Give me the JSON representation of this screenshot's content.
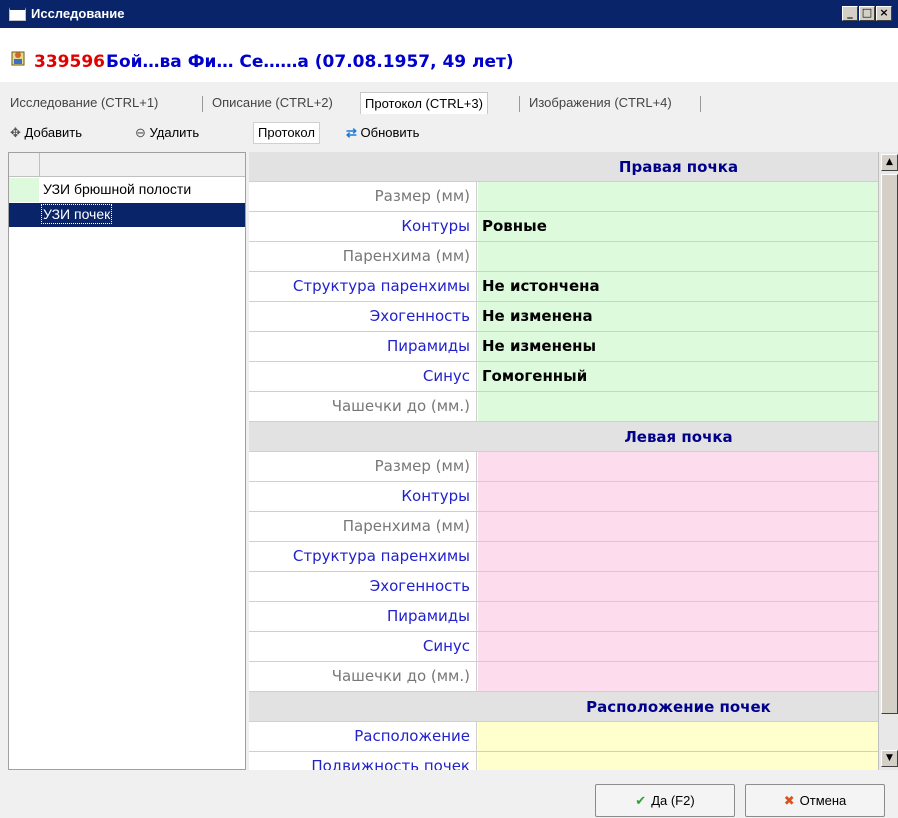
{
  "window": {
    "title": "Исследование",
    "minimize": "_",
    "maximize": "□",
    "close": "×"
  },
  "patient": {
    "id": "339596",
    "name": "Бой…ва Фи… Се……а (07.08.1957, 49 лет)"
  },
  "tabs": [
    {
      "label": "Исследование (CTRL+1)"
    },
    {
      "label": "Описание (CTRL+2)"
    },
    {
      "label": "Протокол (CTRL+3)"
    },
    {
      "label": "Изображения (CTRL+4)"
    }
  ],
  "left_toolbar": {
    "add": "Добавить",
    "remove": "Удалить"
  },
  "right_toolbar": {
    "protocol": "Протокол",
    "refresh": "Обновить"
  },
  "studies": [
    {
      "label": "УЗИ брюшной полости"
    },
    {
      "label": "УЗИ почек"
    }
  ],
  "sections": [
    {
      "title": "Правая почка",
      "rows": [
        {
          "label": "Размер (мм)",
          "value": ""
        },
        {
          "label": "Контуры",
          "value": "Ровные"
        },
        {
          "label": "Паренхима (мм)",
          "value": ""
        },
        {
          "label": "Структура паренхимы",
          "value": "Не истончена"
        },
        {
          "label": "Эхогенность",
          "value": "Не изменена"
        },
        {
          "label": "Пирамиды",
          "value": "Не изменены"
        },
        {
          "label": "Синус",
          "value": "Гомогенный"
        },
        {
          "label": "Чашечки до (мм.)",
          "value": ""
        }
      ]
    },
    {
      "title": "Левая почка",
      "rows": [
        {
          "label": "Размер (мм)",
          "value": ""
        },
        {
          "label": "Контуры",
          "value": ""
        },
        {
          "label": "Паренхима (мм)",
          "value": ""
        },
        {
          "label": "Структура паренхимы",
          "value": ""
        },
        {
          "label": "Эхогенность",
          "value": ""
        },
        {
          "label": "Пирамиды",
          "value": ""
        },
        {
          "label": "Синус",
          "value": ""
        },
        {
          "label": "Чашечки до (мм.)",
          "value": ""
        }
      ]
    },
    {
      "title": "Расположение почек",
      "rows": [
        {
          "label": "Расположение",
          "value": ""
        },
        {
          "label": "Подвижность почек",
          "value": ""
        }
      ]
    }
  ],
  "buttons": {
    "ok": "Да (F2)",
    "cancel": "Отмена"
  },
  "colors": {
    "titlebar": "#0a246a",
    "right_kidney_bg": "#ddfbdc",
    "left_kidney_bg": "#fddded",
    "position_bg": "#ffffcd",
    "selected_row": "#0a246a",
    "patient_id": "#e00000",
    "patient_name": "#0000cc"
  }
}
